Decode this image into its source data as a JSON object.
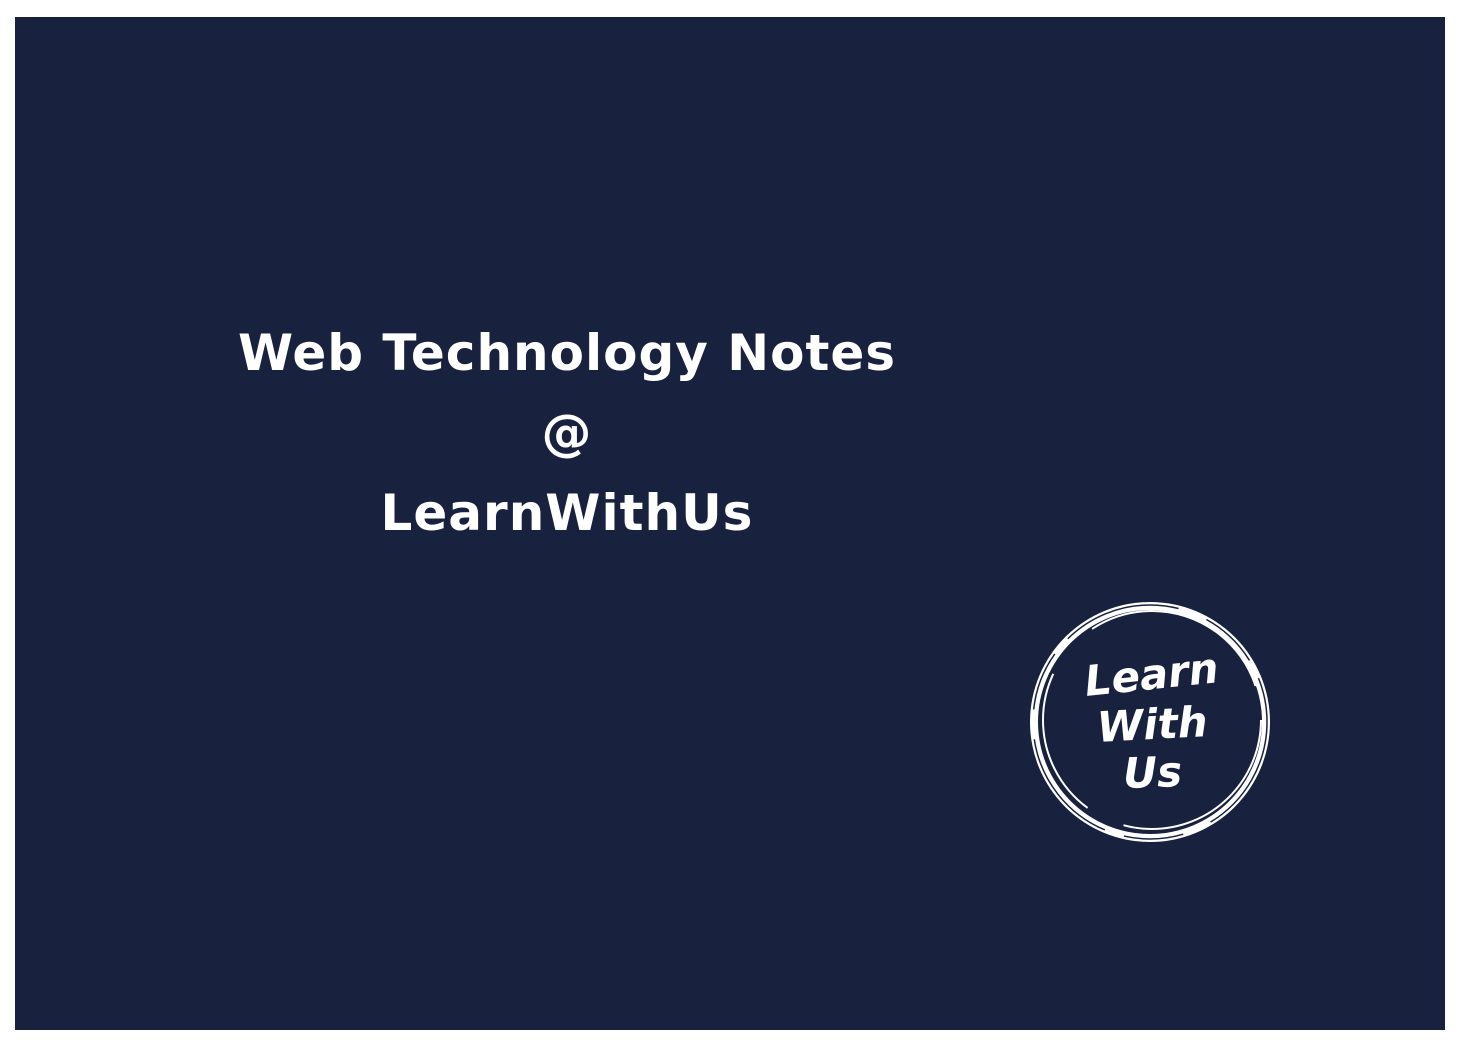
{
  "cover": {
    "title_line1": "Web Technology Notes",
    "title_line2": "@",
    "title_line3": "LearnWithUs",
    "background_color": "#18223f",
    "text_color": "#ffffff"
  },
  "logo": {
    "icon": "circle-badge-logo",
    "line1": "Learn",
    "line2": "With",
    "line3": "Us"
  }
}
